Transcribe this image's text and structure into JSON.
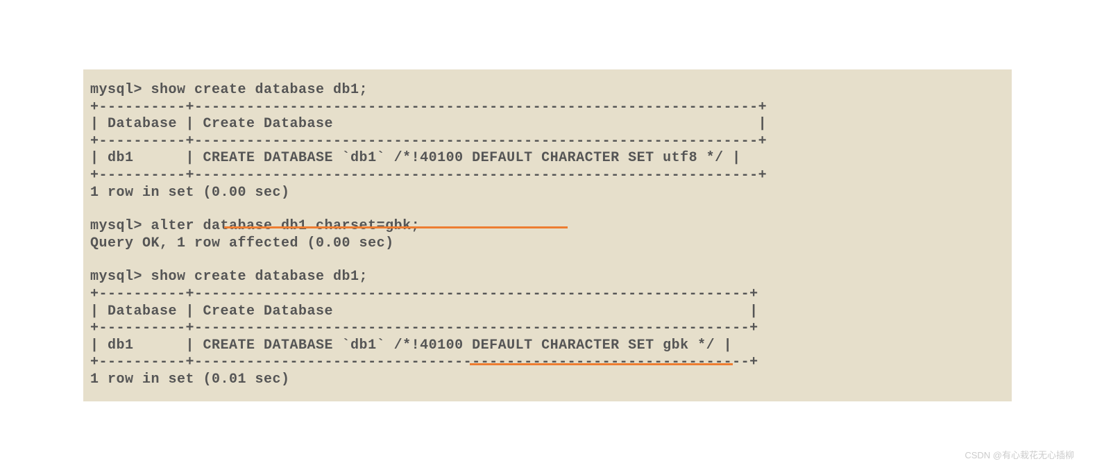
{
  "terminal": {
    "lines": [
      "mysql> show create database db1;",
      "+----------+-----------------------------------------------------------------+",
      "| Database | Create Database                                                 |",
      "+----------+-----------------------------------------------------------------+",
      "| db1      | CREATE DATABASE `db1` /*!40100 DEFAULT CHARACTER SET utf8 */ |",
      "+----------+-----------------------------------------------------------------+",
      "1 row in set (0.00 sec)",
      "",
      "mysql> alter database db1 charset=gbk;",
      "Query OK, 1 row affected (0.00 sec)",
      "",
      "mysql> show create database db1;",
      "+----------+----------------------------------------------------------------+",
      "| Database | Create Database                                                |",
      "+----------+----------------------------------------------------------------+",
      "| db1      | CREATE DATABASE `db1` /*!40100 DEFAULT CHARACTER SET gbk */ |",
      "+----------+----------------------------------------------------------------+",
      "1 row in set (0.01 sec)"
    ]
  },
  "watermark": "CSDN @有心栽花无心插柳"
}
